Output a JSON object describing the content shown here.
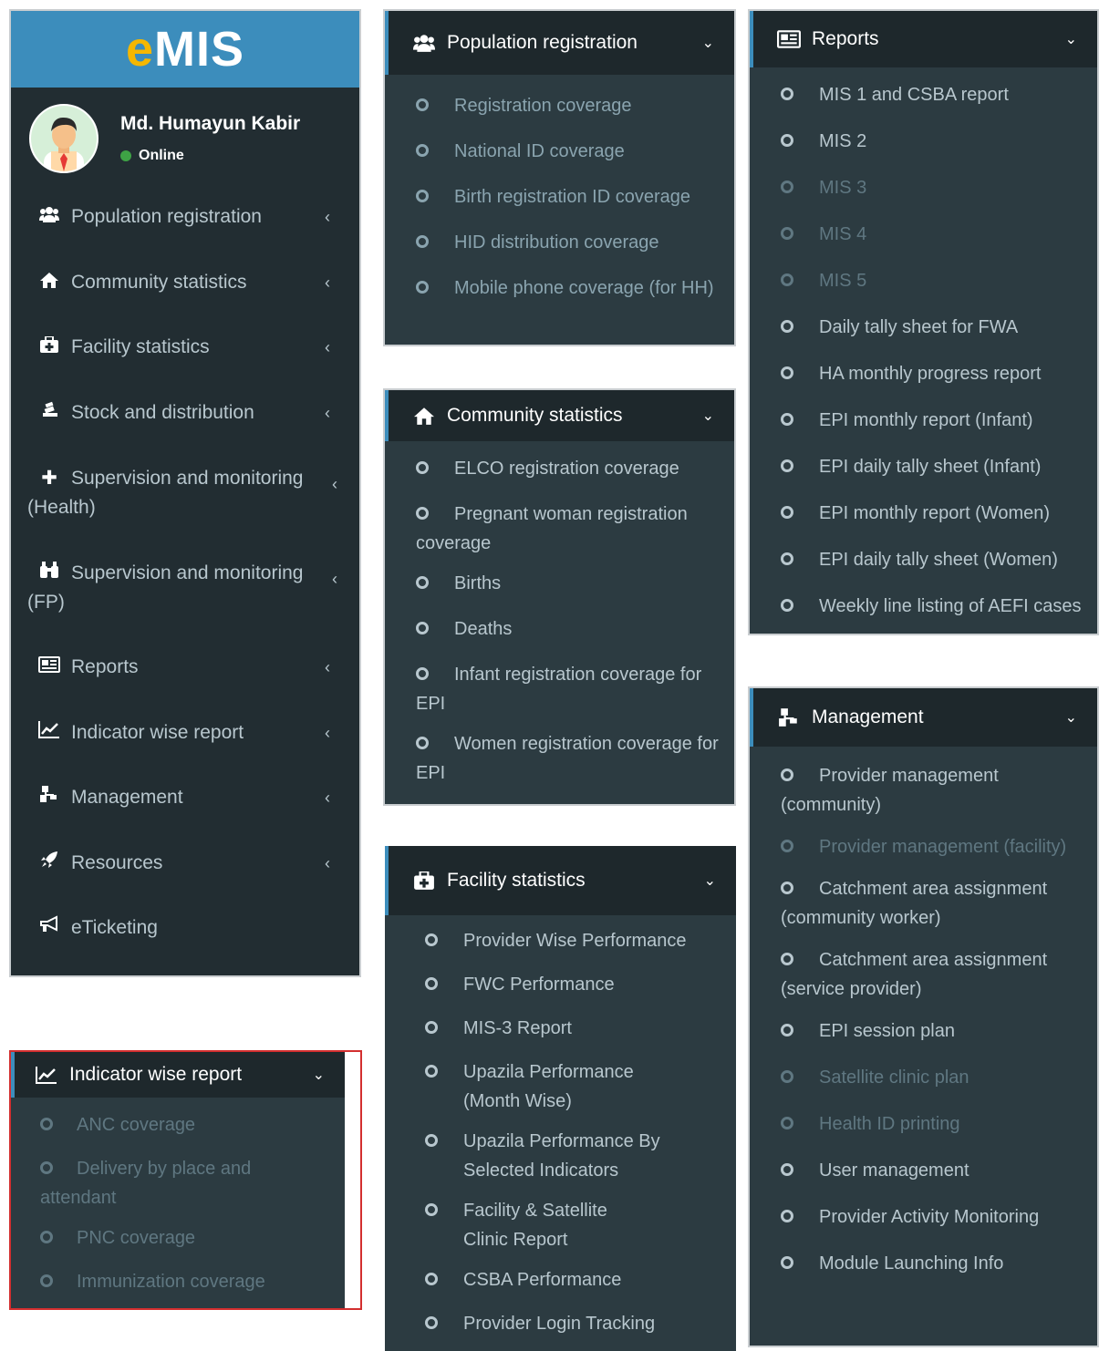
{
  "sidebar": {
    "logo_e": "e",
    "logo_rest": "MIS",
    "user_name": "Md. Humayun Kabir",
    "user_status": "Online",
    "items": [
      {
        "label": "Population registration"
      },
      {
        "label": "Community statistics"
      },
      {
        "label": "Facility statistics"
      },
      {
        "label": "Stock and distribution"
      },
      {
        "label": "Supervision and monitoring",
        "label2": "(Health)"
      },
      {
        "label": "Supervision and monitoring",
        "label2": "(FP)"
      },
      {
        "label": "Reports"
      },
      {
        "label": "Indicator wise report"
      },
      {
        "label": "Management"
      },
      {
        "label": "Resources"
      },
      {
        "label": "eTicketing"
      }
    ]
  },
  "population": {
    "title": "Population registration",
    "items": [
      "Registration coverage",
      "National ID coverage",
      "Birth registration ID coverage",
      "HID distribution coverage",
      "Mobile phone coverage (for HH)"
    ]
  },
  "community": {
    "title": "Community statistics",
    "items": [
      "ELCO registration coverage",
      "Pregnant woman registration coverage",
      "Births",
      "Deaths",
      "Infant registration coverage for EPI",
      "Women registration coverage for EPI"
    ]
  },
  "facility": {
    "title": "Facility statistics",
    "items": [
      "Provider Wise Performance",
      "FWC Performance",
      "MIS-3 Report",
      "Upazila Performance (Month Wise)",
      "Upazila Performance By Selected Indicators",
      "Facility & Satellite Clinic Report",
      "CSBA Performance",
      "Provider Login Tracking"
    ]
  },
  "reports": {
    "title": "Reports",
    "items": [
      "MIS 1 and CSBA report",
      "MIS 2",
      "MIS 3",
      "MIS 4",
      "MIS 5",
      "Daily tally sheet for FWA",
      "HA monthly progress report",
      "EPI monthly report (Infant)",
      "EPI daily tally sheet (Infant)",
      "EPI monthly report (Women)",
      "EPI daily tally sheet (Women)",
      "Weekly line listing of AEFI cases"
    ]
  },
  "management": {
    "title": "Management",
    "items": [
      "Provider management (community)",
      "Provider management (facility)",
      "Catchment area assignment (community worker)",
      "Catchment area assignment (service provider)",
      "EPI session plan",
      "Satellite clinic plan",
      "Health ID printing",
      "User management",
      "Provider Activity Monitoring",
      "Module Launching Info"
    ]
  },
  "indicator": {
    "title": "Indicator wise report",
    "items": [
      "ANC coverage",
      "Delivery by place and attendant",
      "PNC coverage",
      "Immunization coverage"
    ]
  },
  "colors": {
    "brand_blue": "#3c8dbc",
    "sidebar_bg": "#2c3b41",
    "header_bg": "#1e282c",
    "logo_yellow": "#f5b700",
    "online_green": "#3ea345",
    "highlight_red": "#d32f2f"
  }
}
